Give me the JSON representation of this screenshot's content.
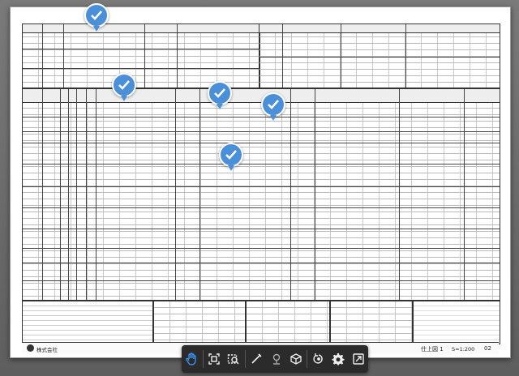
{
  "viewer": {
    "accent": "#3b8ff0",
    "pin_color": "#4a8fd8",
    "toolbar": [
      {
        "name": "hand-tool",
        "icon": "hand-icon",
        "active": true
      },
      {
        "name": "fit-page",
        "icon": "fit-screen-icon"
      },
      {
        "name": "zoom-area",
        "icon": "zoom-area-icon"
      },
      {
        "name": "pen-tool",
        "icon": "pen-icon"
      },
      {
        "name": "pin-tool",
        "icon": "pin-icon"
      },
      {
        "name": "box-3d",
        "icon": "cube-icon"
      },
      {
        "name": "rotate",
        "icon": "rotate-icon"
      },
      {
        "name": "settings",
        "icon": "gear-icon"
      },
      {
        "name": "fullscreen",
        "icon": "expand-icon"
      }
    ]
  },
  "drawing": {
    "title": "仕上図 1",
    "scale": "S=1:200",
    "sheet_no": "02",
    "company": "株式会社"
  }
}
